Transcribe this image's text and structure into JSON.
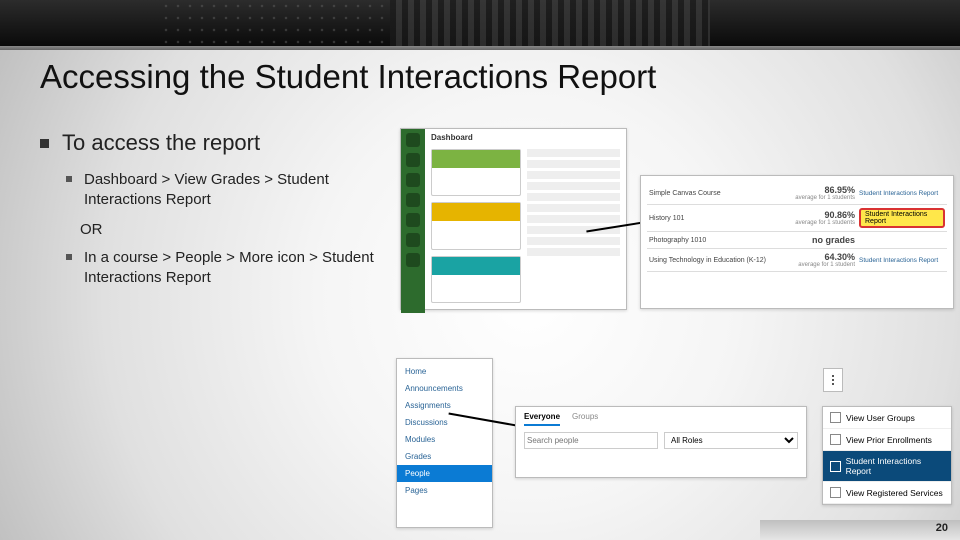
{
  "title": "Accessing the Student Interactions Report",
  "bullets": {
    "lvl1": "To access the report",
    "path1": "Dashboard > View Grades > Student Interactions Report",
    "or": "OR",
    "path2": "In a course > People > More icon > Student Interactions Report"
  },
  "dashboard": {
    "header": "Dashboard"
  },
  "grades_table": {
    "rows": [
      {
        "course": "Simple Canvas Course",
        "pct": "86.95%",
        "sub": "average for 1 students",
        "link": "Student Interactions Report",
        "highlight": false
      },
      {
        "course": "History 101",
        "pct": "90.86%",
        "sub": "average for 1 students",
        "link": "Student Interactions Report",
        "highlight": true
      },
      {
        "course": "Photography 1010",
        "pct": "no grades",
        "sub": "",
        "link": "",
        "highlight": false
      },
      {
        "course": "Using Technology in Education (K-12)",
        "pct": "64.30%",
        "sub": "average for 1 student",
        "link": "Student Interactions Report",
        "highlight": false
      }
    ]
  },
  "course_nav": {
    "items": [
      "Home",
      "Announcements",
      "Assignments",
      "Discussions",
      "Modules",
      "Grades",
      "People",
      "Pages"
    ],
    "selected": "People"
  },
  "people_panel": {
    "tabs": [
      "Everyone",
      "Groups"
    ],
    "search_placeholder": "Search people",
    "role_placeholder": "All Roles"
  },
  "more_menu": {
    "items": [
      "View User Groups",
      "View Prior Enrollments",
      "Student Interactions Report",
      "View Registered Services"
    ],
    "selected": "Student Interactions Report"
  },
  "page_number": "20"
}
